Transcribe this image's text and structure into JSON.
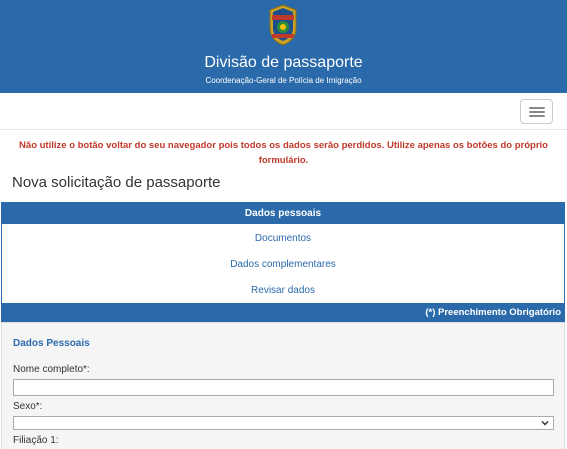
{
  "header": {
    "badge_text_top": "POLÍCIA",
    "badge_text_bottom": "FEDERAL",
    "title": "Divisão de passaporte",
    "subtitle": "Coordenação-Geral de Polícia de Imigração"
  },
  "navbar": {
    "menu_icon": "hamburger-menu-icon"
  },
  "warning": "Não utilize o botão voltar do seu navegador pois todos os dados serão perdidos. Utilize apenas os botões do próprio formulário.",
  "page_title": "Nova solicitação de passaporte",
  "steps": {
    "active": "Dados pessoais",
    "items": [
      "Documentos",
      "Dados complementares",
      "Revisar dados"
    ]
  },
  "required_note": "(*) Preenchimento Obrigatório",
  "form": {
    "section_title": "Dados Pessoais",
    "full_name_label": "Nome completo*:",
    "full_name_value": "",
    "sex_label": "Sexo*:",
    "sex_value": "",
    "filiation_label": "Filiação 1:"
  },
  "colors": {
    "primary": "#2a6aaa",
    "warning": "#c0392b",
    "panel_bg": "#f5f5f5"
  }
}
